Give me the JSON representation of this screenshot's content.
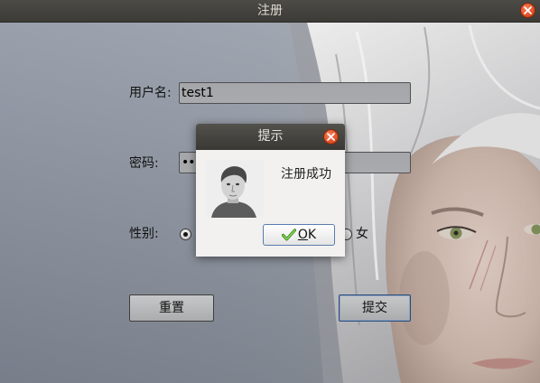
{
  "window": {
    "title": "注册",
    "close_icon": "close-icon"
  },
  "form": {
    "username": {
      "label": "用户名:",
      "value": "test1"
    },
    "password": {
      "label": "密码:",
      "value": "•••"
    },
    "gender": {
      "label": "性别:",
      "options": [
        {
          "selected": true
        },
        {
          "label": "女",
          "selected": false
        }
      ]
    }
  },
  "buttons": {
    "reset": "重置",
    "submit": "提交"
  },
  "dialog": {
    "title": "提示",
    "message": "注册成功",
    "ok_label": "OK",
    "ok_icon": "check-icon",
    "close_icon": "close-icon",
    "avatar_icon": "user-photo-icon"
  },
  "colors": {
    "title_bar": "#3c3b37",
    "close_button": "#e5532a",
    "dialog_background": "#f2f1f0",
    "field_background": "#a9aaad",
    "focus_border": "#5b7cae"
  }
}
